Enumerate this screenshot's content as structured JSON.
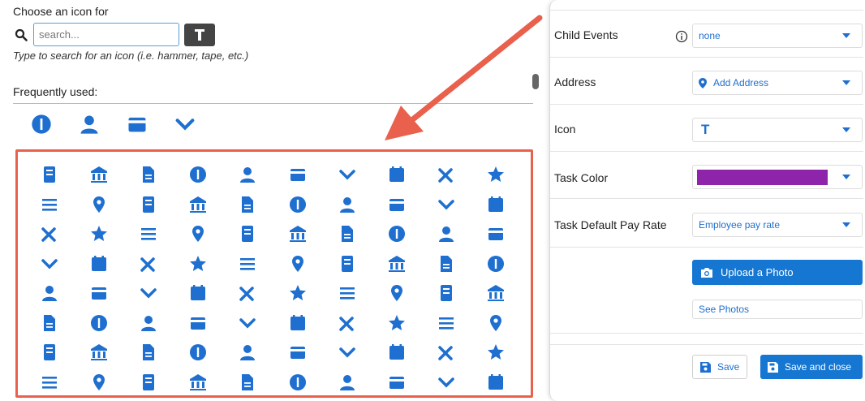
{
  "picker": {
    "title": "Choose an icon for",
    "search_placeholder": "search...",
    "hint": "Type to search for an icon (i.e. hammer, tape, etc.)",
    "frequent_label": "Frequently used:",
    "frequent_icons": [
      "cheers-icon",
      "city-icon",
      "shower-icon",
      "feather-icon"
    ],
    "grid_icons": [
      "thermometer-icon",
      "bank-icon",
      "document-icon",
      "dollar-sign-icon",
      "institution-icon",
      "copy-icon",
      "dollar-circle-icon",
      "user-circle-icon",
      "building-icon",
      "office-building-icon",
      "credit-card-icon",
      "baht-icon",
      "more-box-icon",
      "edit-folder-icon",
      "chevron-down-icon",
      "calendar-icon",
      "excel-file-icon",
      "image-file-icon",
      "pdf-file-icon",
      "parking-icon",
      "word-file-icon",
      "video-file-icon",
      "blank-file-icon",
      "microphone-icon",
      "tags-icon",
      "text-cursor-box-icon",
      "truck-icon",
      "clipboard-arrow-icon",
      "factory-icon",
      "menu-icon",
      "square-outline-icon",
      "close-icon",
      "star-icon",
      "caret-down-icon",
      "handshake-icon",
      "vertical-height-icon",
      "folder-icon",
      "grid-folder-icon",
      "receipt-icon",
      "location-pin-icon",
      "mail-icon",
      "money-bag-icon",
      "worker-icon",
      "chart-folder-icon",
      "notebook-icon",
      "barcode-icon",
      "stairs-icon",
      "book-icon",
      "calendar-grid-icon",
      "safe-icon",
      "support-icon",
      "archive-upload-icon",
      "cart-icon",
      "stamp-icon",
      "calculator-icon",
      "width-icon",
      "dolly-icon",
      "hand-truck-icon",
      "lift-icon",
      "pump-icon",
      "box-icon",
      "circle-outline-icon",
      "list-icon",
      "numbered-list-icon",
      "question-icon",
      "shower-icon",
      "sort-numeric-icon",
      "checklist-icon",
      "push-pin-icon",
      "stairs-up-icon",
      "card-icon",
      "projector-icon",
      "clock-icon",
      "upload-folder-icon",
      "zoom-user-icon",
      "mountain-icon",
      "exit-door-icon",
      "file-dots-icon",
      "ledger-icon",
      "medical-box-icon"
    ]
  },
  "panel": {
    "child_events": {
      "label": "Child Events",
      "value": "none"
    },
    "address": {
      "label": "Address",
      "value": "Add Address"
    },
    "icon": {
      "label": "Icon",
      "value": "T"
    },
    "task_color": {
      "label": "Task Color",
      "color": "#8e24aa"
    },
    "pay_rate": {
      "label": "Task Default Pay Rate",
      "value": "Employee pay rate"
    },
    "upload_label": "Upload a Photo",
    "see_photos_label": "See Photos",
    "save_label": "Save",
    "save_close_label": "Save and close"
  },
  "colors": {
    "accent": "#1677d2",
    "highlight": "#e9604d",
    "icon_blue": "#1e6fcf"
  }
}
